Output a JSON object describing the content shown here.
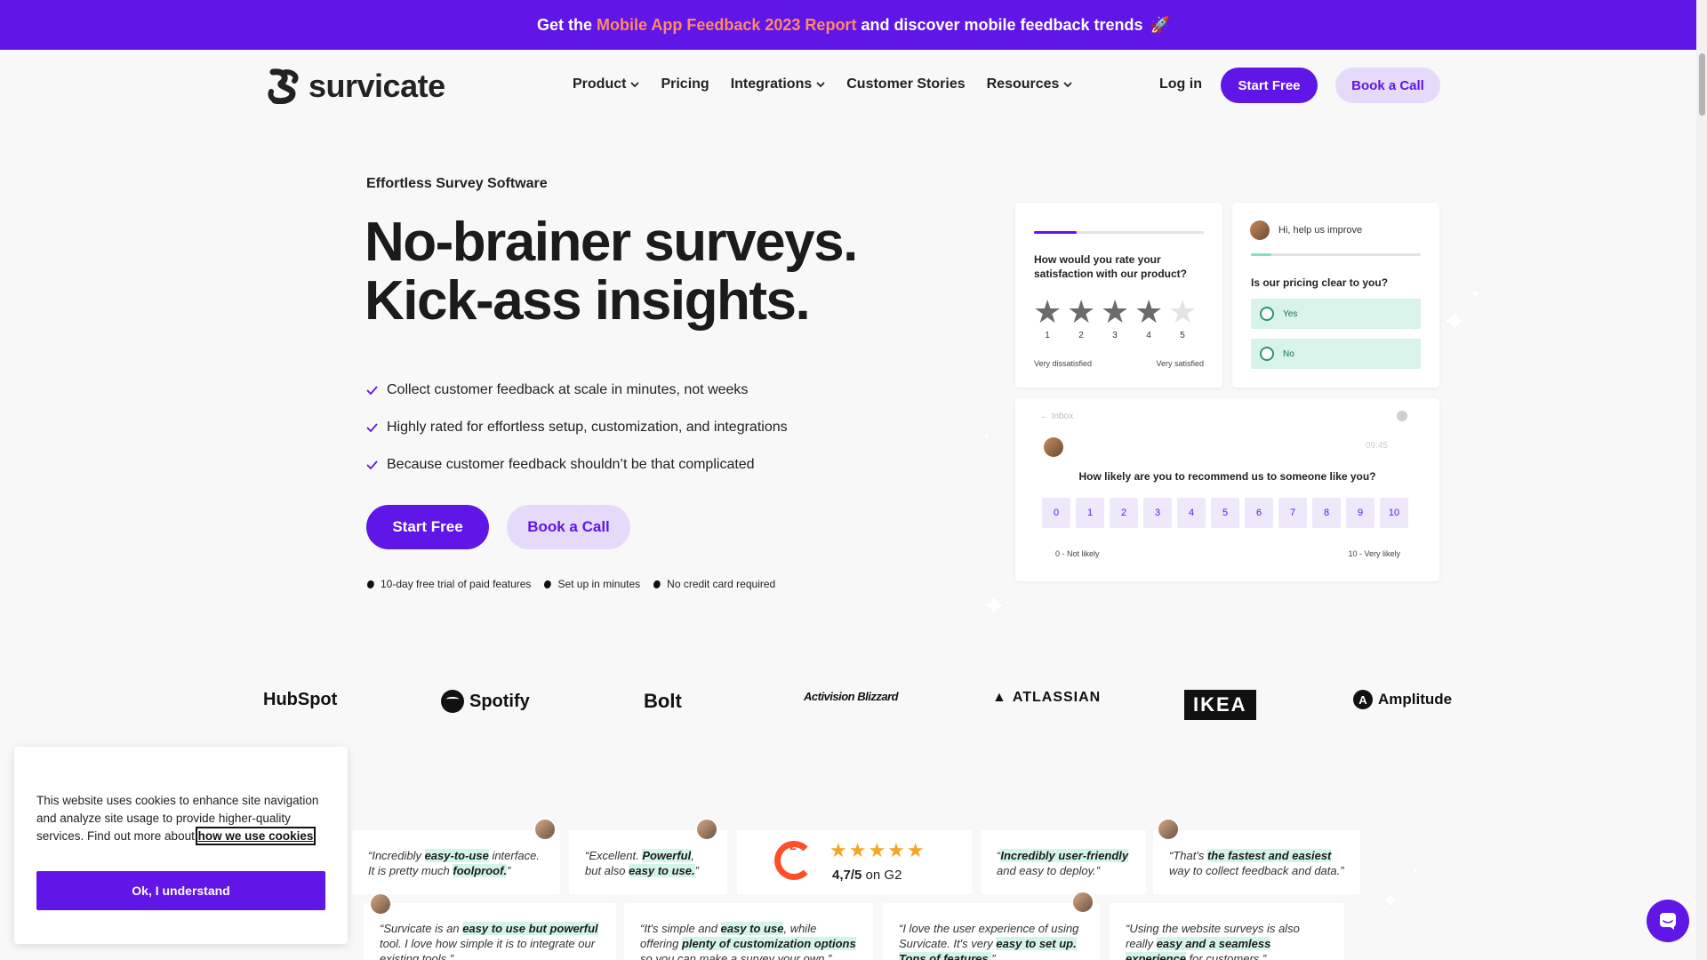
{
  "banner": {
    "prefix": "Get the",
    "highlight": "Mobile App Feedback 2023 Report",
    "suffix": "and discover mobile feedback trends",
    "emoji": "🚀"
  },
  "nav": {
    "logo_text": "survicate",
    "links": [
      {
        "label": "Product",
        "dropdown": true
      },
      {
        "label": "Pricing",
        "dropdown": false
      },
      {
        "label": "Integrations",
        "dropdown": true
      },
      {
        "label": "Customer Stories",
        "dropdown": false
      },
      {
        "label": "Resources",
        "dropdown": true
      }
    ],
    "login": "Log in",
    "start_free": "Start Free",
    "book_call": "Book a Call"
  },
  "hero": {
    "eyebrow": "Effortless Survey Software",
    "headline_1": "No-brainer surveys.",
    "headline_2": "Kick-ass insights.",
    "benefits": [
      "Collect customer feedback at scale in minutes, not weeks",
      "Highly rated for effortless setup, customization, and integrations",
      "Because customer feedback shouldn’t be that complicated"
    ],
    "start_free": "Start Free",
    "book_call": "Book a Call",
    "perks": [
      "10-day free trial of paid features",
      "Set up in minutes",
      "No credit card required"
    ]
  },
  "survey_rating": {
    "progress": 0.25,
    "question": "How would you rate your satisfaction with our product?",
    "rating": 4,
    "scale": [
      "1",
      "2",
      "3",
      "4",
      "5"
    ],
    "low_label": "Very dissatisfied",
    "high_label": "Very satisfied"
  },
  "survey_choice": {
    "greeting": "Hi, help us improve",
    "progress": 0.12,
    "question": "Is our pricing clear to you?",
    "options": [
      "Yes",
      "No"
    ]
  },
  "survey_nps": {
    "inbox_label": "Inbox",
    "time": "09:45",
    "question": "How likely are you to recommend us to someone like you?",
    "scale": [
      "0",
      "1",
      "2",
      "3",
      "4",
      "5",
      "6",
      "7",
      "8",
      "9",
      "10"
    ],
    "low_label": "0 - Not likely",
    "high_label": "10 - Very likely"
  },
  "logos": [
    "HubSpot",
    "Spotify",
    "Bolt",
    "Activision Blizzard",
    "ATLASSIAN",
    "IKEA",
    "Amplitude"
  ],
  "g2": {
    "score": "4,7/5",
    "suffix": "on G2",
    "stars": 5
  },
  "reviews": {
    "r1": {
      "a": "“Incredibly ",
      "b": "easy-to-use",
      "c": " interface. It is pretty much ",
      "d": "foolproof.",
      "e": "”"
    },
    "r2": {
      "a": "“Excellent. ",
      "b": "Powerful",
      "c": ", but also ",
      "d": "easy to use.",
      "e": "”"
    },
    "r3": {
      "a": "“",
      "b": "Incredibly user-friendly",
      "c": " and easy to deploy.”"
    },
    "r4": {
      "a": "“That's ",
      "b": "the fastest and easiest",
      "c": " way to collect feedback and data.”"
    },
    "r5": {
      "a": "“Survicate is an ",
      "b": "easy to use but powerful",
      "c": " tool. I love how simple it is to integrate our existing tools.”"
    },
    "r6": {
      "a": "“It's simple and ",
      "b": "easy to use",
      "c": ", while offering ",
      "d": "plenty of customization options",
      "e": " so you can make a survey your own.”"
    },
    "r7": {
      "a": "“I love the user experience of using Survicate. It's very ",
      "b": "easy to set up. Tons of features.",
      "c": "”"
    },
    "r8": {
      "a": "“Using the website surveys is also really ",
      "b": "easy and a seamless experience",
      "c": " for customers.”"
    }
  },
  "cookie": {
    "text": "This website uses cookies to enhance site navigation and analyze site usage to provide higher-quality services. Find out more about ",
    "link": "how we use cookies",
    "end": ".",
    "button": "Ok, I understand"
  },
  "colors": {
    "brand": "#5f16e6",
    "brand_light": "#e5dafa",
    "banner_highlight": "#ff8a65",
    "highlight_green": "#d3f5e8"
  }
}
